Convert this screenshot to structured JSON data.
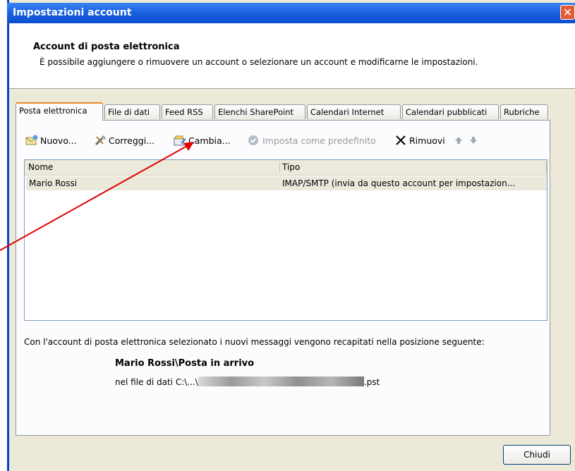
{
  "window": {
    "title": "Impostazioni account",
    "close_glyph": "✕"
  },
  "header": {
    "title": "Account di posta elettronica",
    "subtitle": "È possibile aggiungere o rimuovere un account o selezionare un account e modificarne le impostazioni."
  },
  "tabs": [
    {
      "label": "Posta elettronica",
      "active": true
    },
    {
      "label": "File di dati"
    },
    {
      "label": "Feed RSS"
    },
    {
      "label": "Elenchi SharePoint"
    },
    {
      "label": "Calendari Internet"
    },
    {
      "label": "Calendari pubblicati"
    },
    {
      "label": "Rubriche"
    }
  ],
  "toolbar": {
    "new_label": "Nuovo...",
    "repair_label": "Correggi...",
    "change_label": "Cambia...",
    "default_label": "Imposta come predefinito",
    "remove_label": "Rimuovi"
  },
  "list": {
    "columns": [
      "Nome",
      "Tipo"
    ],
    "rows": [
      {
        "name": "Mario Rossi",
        "type": "IMAP/SMTP (invia da questo account per impostazion..."
      }
    ]
  },
  "delivery": {
    "info": "Con l'account di posta elettronica selezionato i nuovi messaggi vengono recapitati nella posizione seguente:",
    "location": "Mario Rossi\\Posta in arrivo",
    "file_prefix": "nel file di dati C:\\...\\",
    "file_suffix": ".pst"
  },
  "buttons": {
    "close_label": "Chiudi"
  },
  "colors": {
    "title_bar": "#1c63e0",
    "annotation_arrow": "#e00000",
    "active_tab_accent": "#e68b2c"
  }
}
